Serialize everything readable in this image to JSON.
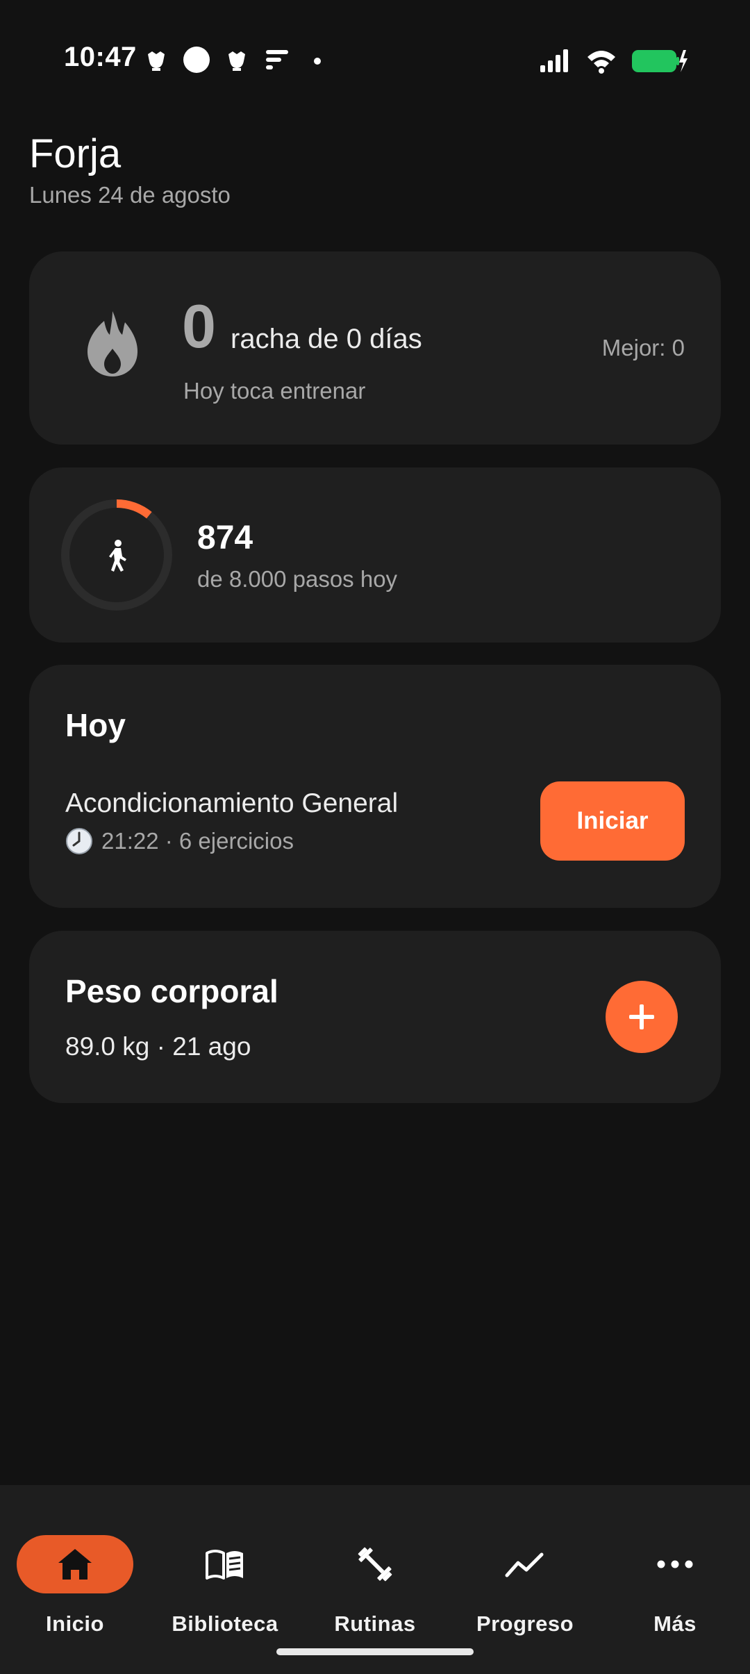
{
  "status_bar": {
    "time": "10:47",
    "left_icons": [
      "bug-icon",
      "circle-icon",
      "bug-icon",
      "signal-lines-icon",
      "dot-icon"
    ],
    "right_icons": [
      "cell-signal-icon",
      "wifi-icon",
      "battery-charging-icon"
    ],
    "battery_color": "#22c55e"
  },
  "header": {
    "title": "Forja",
    "date": "Lunes 24 de agosto"
  },
  "streak": {
    "icon": "flame-icon",
    "count": "0",
    "label": "racha de 0 días",
    "subtitle": "Hoy toca entrenar",
    "best": "Mejor: 0"
  },
  "steps": {
    "icon": "walk-icon",
    "count": "874",
    "subtitle": "de 8.000 pasos hoy",
    "progress": 0.109
  },
  "today": {
    "title": "Hoy",
    "workout_name": "Acondicionamiento General",
    "meta_icon": "clock-icon",
    "meta": "21:22 · 6 ejercicios",
    "start_label": "Iniciar"
  },
  "weight": {
    "title": "Peso corporal",
    "value": "89.0 kg · 21 ago",
    "add_icon": "plus-icon"
  },
  "nav": {
    "items": [
      {
        "label": "Inicio",
        "icon": "home-icon",
        "active": true
      },
      {
        "label": "Biblioteca",
        "icon": "book-icon",
        "active": false
      },
      {
        "label": "Rutinas",
        "icon": "dumbbell-icon",
        "active": false
      },
      {
        "label": "Progreso",
        "icon": "trend-icon",
        "active": false
      },
      {
        "label": "Más",
        "icon": "more-icon",
        "active": false
      }
    ]
  },
  "colors": {
    "accent": "#ff6b35",
    "active_nav": "#e85a28",
    "background": "#121212",
    "card": "#1f1f1f"
  }
}
